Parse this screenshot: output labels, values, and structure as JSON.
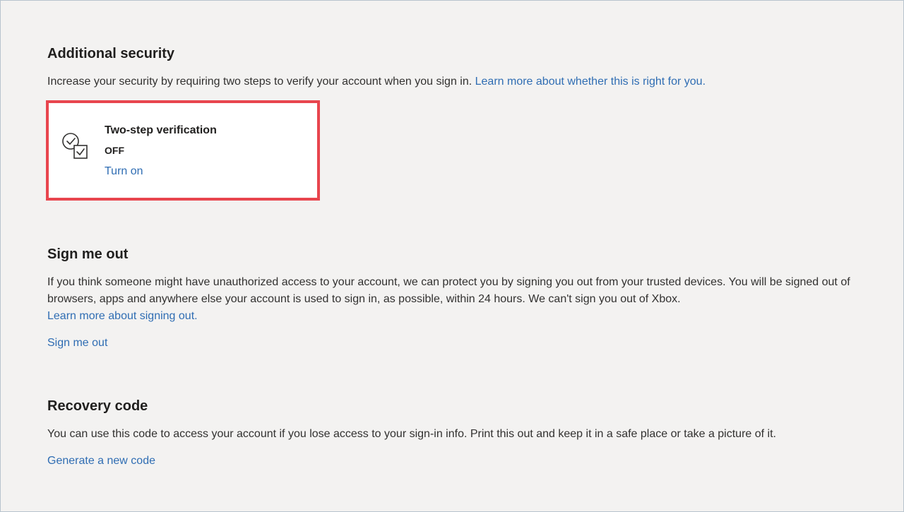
{
  "additional_security": {
    "heading": "Additional security",
    "description": "Increase your security by requiring two steps to verify your account when you sign in. ",
    "learn_more": "Learn more about whether this is right for you.",
    "card": {
      "icon": "two-step-verification-icon",
      "title": "Two-step verification",
      "status": "OFF",
      "action": "Turn on",
      "highlight_color": "#e8454e"
    }
  },
  "sign_me_out": {
    "heading": "Sign me out",
    "description": "If you think someone might have unauthorized access to your account, we can protect you by signing you out from your trusted devices. You will be signed out of browsers, apps and anywhere else your account is used to sign in, as possible, within 24 hours. We can't sign you out of Xbox.",
    "learn_more": "Learn more about signing out.",
    "action": "Sign me out"
  },
  "recovery_code": {
    "heading": "Recovery code",
    "description": "You can use this code to access your account if you lose access to your sign-in info. Print this out and keep it in a safe place or take a picture of it.",
    "action": "Generate a new code"
  },
  "colors": {
    "background": "#f3f2f1",
    "link": "#2f6db3",
    "text": "#323130"
  }
}
